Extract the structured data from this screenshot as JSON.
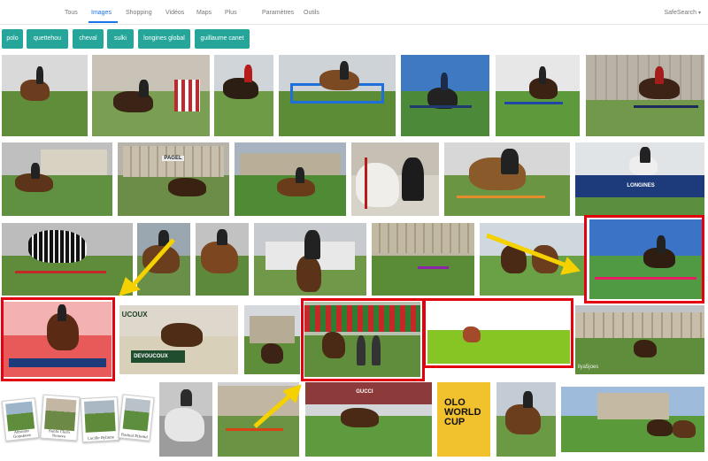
{
  "tabs": [
    {
      "label": "Tous",
      "active": false
    },
    {
      "label": "Images",
      "active": true
    },
    {
      "label": "Shopping",
      "active": false
    },
    {
      "label": "Vidéos",
      "active": false
    },
    {
      "label": "Maps",
      "active": false
    },
    {
      "label": "Plus",
      "active": false
    },
    {
      "label": "Paramètres",
      "active": false
    },
    {
      "label": "Outils",
      "active": false
    }
  ],
  "safesearch": {
    "label": "SafeSearch",
    "caret": "▾"
  },
  "chips": [
    {
      "label": "polo"
    },
    {
      "label": "quettehou"
    },
    {
      "label": "cheval"
    },
    {
      "label": "sulki"
    },
    {
      "label": "longines global"
    },
    {
      "label": "guillaume canet"
    }
  ],
  "image_text": {
    "pagel": "PAGEL",
    "longines_banner": "LONGINES",
    "devoucoux": "DEVOUCOUX",
    "ducou": "UCOUX",
    "gucci": "GUCCI",
    "poster_title": "OLO WORLD CUP",
    "watermark": "ilya5joes",
    "polaroid_captions": [
      "Almonte Gonnkees",
      "Santa Clara Renova",
      "Lucille Bylinne",
      "Rodnal Ethelid"
    ],
    "longines_rail": "LONGINES"
  },
  "colors": {
    "accent": "#1a73e8",
    "chip": "#26a69a",
    "highlight": "#e3000f",
    "arrow": "#f5d100"
  }
}
